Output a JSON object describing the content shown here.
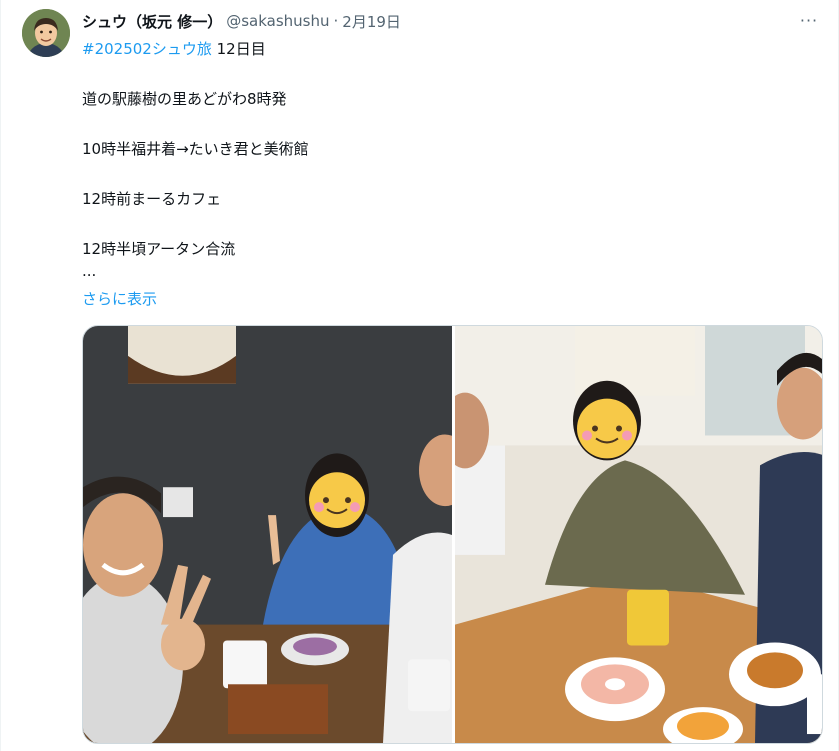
{
  "author": {
    "display_name": "シュウ（坂元 修一）",
    "handle": "@sakashushu",
    "separator": "·",
    "date": "2月19日",
    "avatar_icon": "user-avatar-icon"
  },
  "more_icon": {
    "glyph": "···",
    "icon": "more-options-icon"
  },
  "tweet": {
    "hashtag": "#202502シュウ旅",
    "day_label": " 12日目",
    "lines": [
      "道の駅藤樹の里あどがわ8時発",
      "10時半福井着→たいき君と美術館",
      "12時前まーるカフェ",
      "12時半頃アータン合流",
      "..."
    ],
    "show_more": "さらに表示"
  },
  "colors": {
    "link": "#1d9bf0",
    "secondary_text": "#536471",
    "primary_text": "#0f1419",
    "border": "#cfd9de"
  },
  "media": {
    "count": 2
  }
}
